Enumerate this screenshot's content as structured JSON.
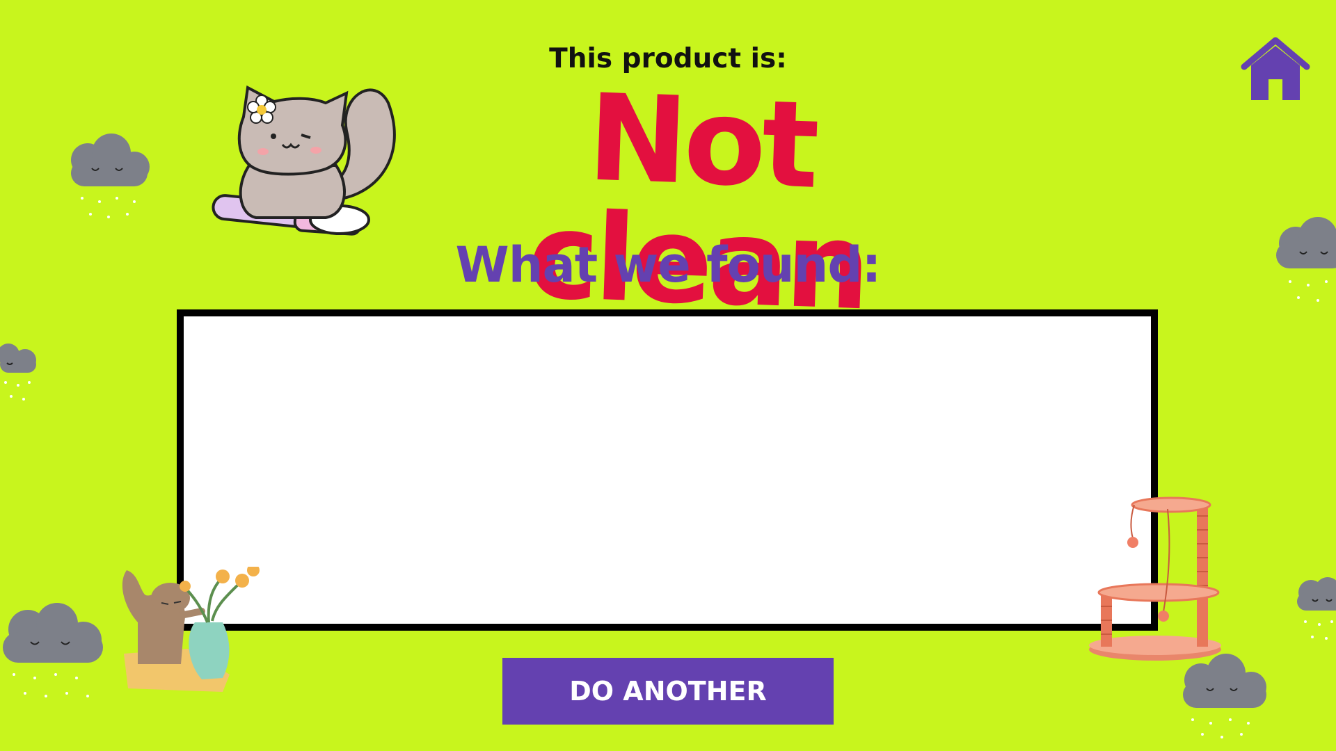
{
  "header": {
    "subtitle": "This product is:",
    "result": "Not clean",
    "section_label": "What we found:"
  },
  "results": {
    "content": ""
  },
  "actions": {
    "do_another_label": "DO ANOTHER"
  },
  "nav": {
    "home_icon": "home-icon"
  },
  "colors": {
    "background": "#c8f51d",
    "result_red": "#e3103f",
    "accent_purple": "#6441b0",
    "cloud_gray": "#7d8089"
  },
  "decorations": [
    "rain-cloud-icon",
    "cat-on-pen-illustration",
    "cat-with-vase-illustration",
    "cat-tree-illustration"
  ]
}
